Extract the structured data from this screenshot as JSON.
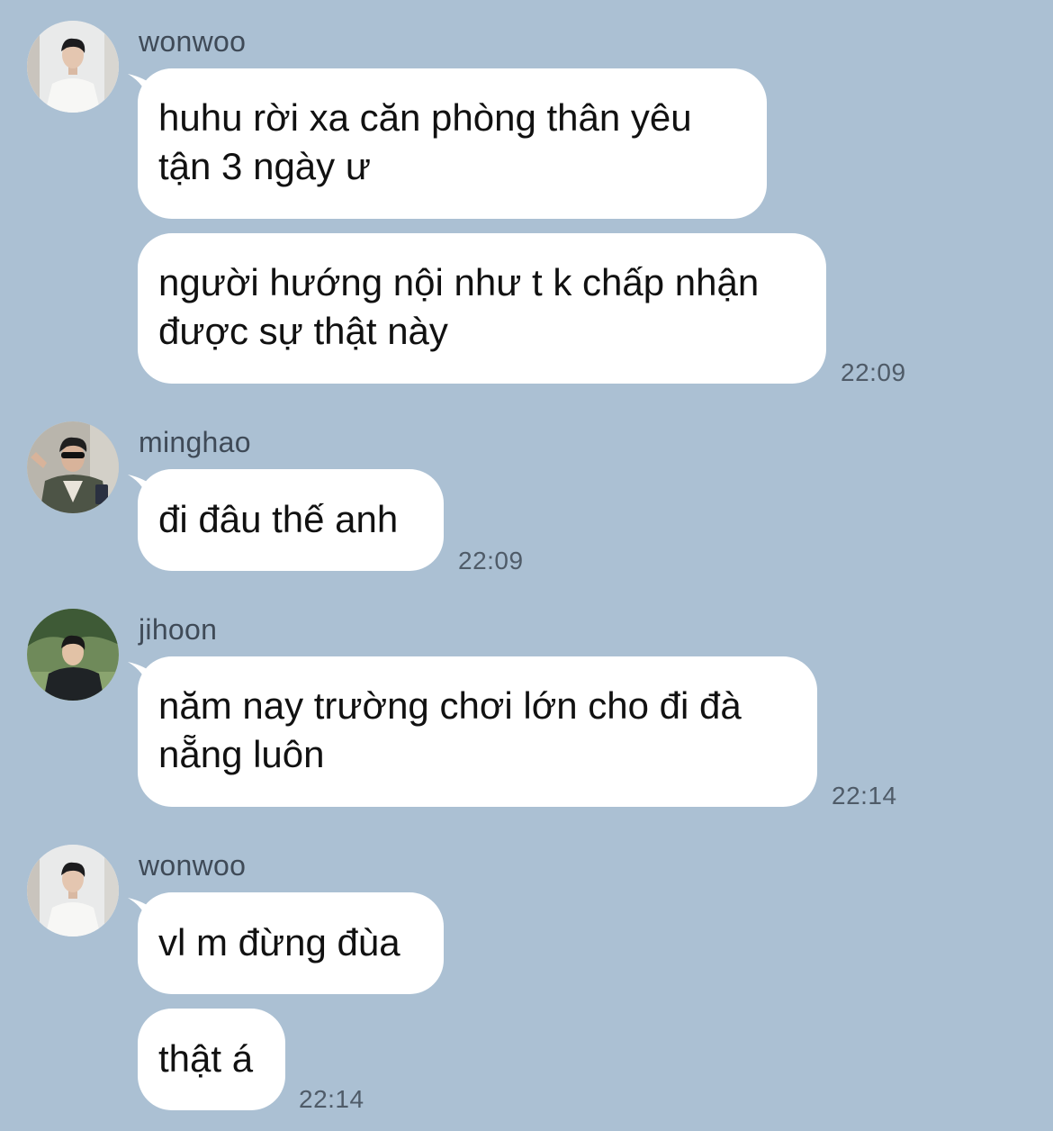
{
  "messages": [
    {
      "sender": "wonwoo",
      "avatar": "avatar-wonwoo",
      "bubbles": [
        {
          "lines": [
            "huhu rời xa căn phòng thân yêu",
            "tận 3 ngày ư"
          ]
        },
        {
          "lines": [
            "người hướng nội như t k chấp nhận",
            "được sự thật này"
          ],
          "time": "22:09"
        }
      ]
    },
    {
      "sender": "minghao",
      "avatar": "avatar-minghao",
      "bubbles": [
        {
          "lines": [
            "đi đâu thế anh"
          ],
          "time": "22:09"
        }
      ]
    },
    {
      "sender": "jihoon",
      "avatar": "avatar-jihoon",
      "bubbles": [
        {
          "lines": [
            "năm nay trường chơi lớn cho đi đà",
            "nẵng luôn"
          ],
          "time": "22:14"
        }
      ]
    },
    {
      "sender": "wonwoo",
      "avatar": "avatar-wonwoo",
      "bubbles": [
        {
          "lines": [
            "vl m đừng đùa"
          ]
        },
        {
          "lines": [
            "thật á"
          ],
          "time": "22:14"
        }
      ]
    }
  ],
  "colors": {
    "background": "#abc0d3",
    "bubble": "#ffffff",
    "sender_text": "#3f4a57",
    "time_text": "#4f5b68"
  }
}
